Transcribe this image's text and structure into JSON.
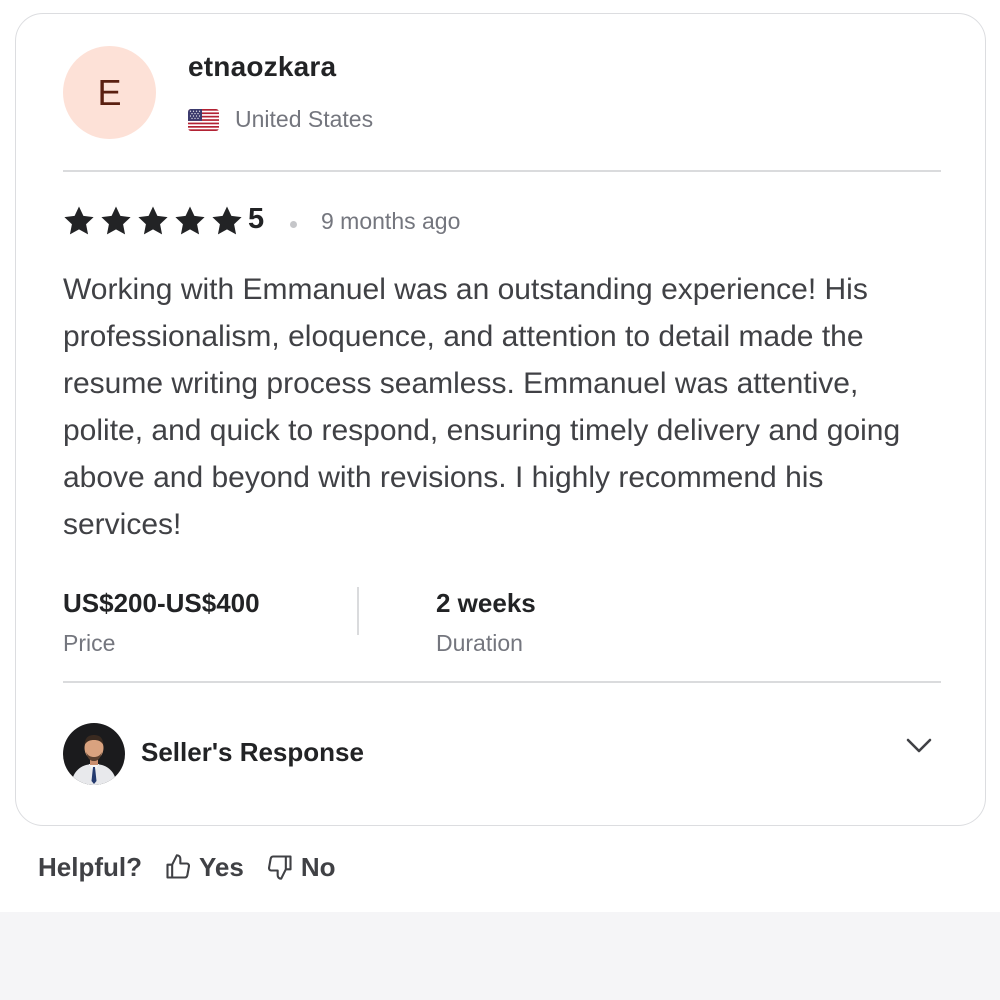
{
  "reviewer": {
    "initial": "E",
    "username": "etnaozkara",
    "country": "United States",
    "flag_icon": "us-flag-icon",
    "avatar_bg": "#fde1d7"
  },
  "rating": {
    "stars": 5,
    "max_stars": 5,
    "value": "5",
    "time_ago": "9 months ago"
  },
  "review": {
    "text": "Working with Emmanuel was an outstanding experience! His professionalism, eloquence, and attention to detail made the resume writing process seamless. Emmanuel was attentive, polite, and quick to respond, ensuring timely delivery and going above and beyond with revisions. I highly recommend his services!"
  },
  "details": {
    "price_value": "US$200-US$400",
    "price_label": "Price",
    "duration_value": "2 weeks",
    "duration_label": "Duration"
  },
  "seller_response": {
    "title": "Seller's Response",
    "expand_icon": "chevron-down-icon"
  },
  "helpful": {
    "label": "Helpful?",
    "yes_label": "Yes",
    "no_label": "No",
    "yes_icon": "thumbs-up-icon",
    "no_icon": "thumbs-down-icon"
  },
  "colors": {
    "text_primary": "#222325",
    "text_secondary": "#74767e",
    "star": "#222325",
    "border": "#dadbdd"
  }
}
